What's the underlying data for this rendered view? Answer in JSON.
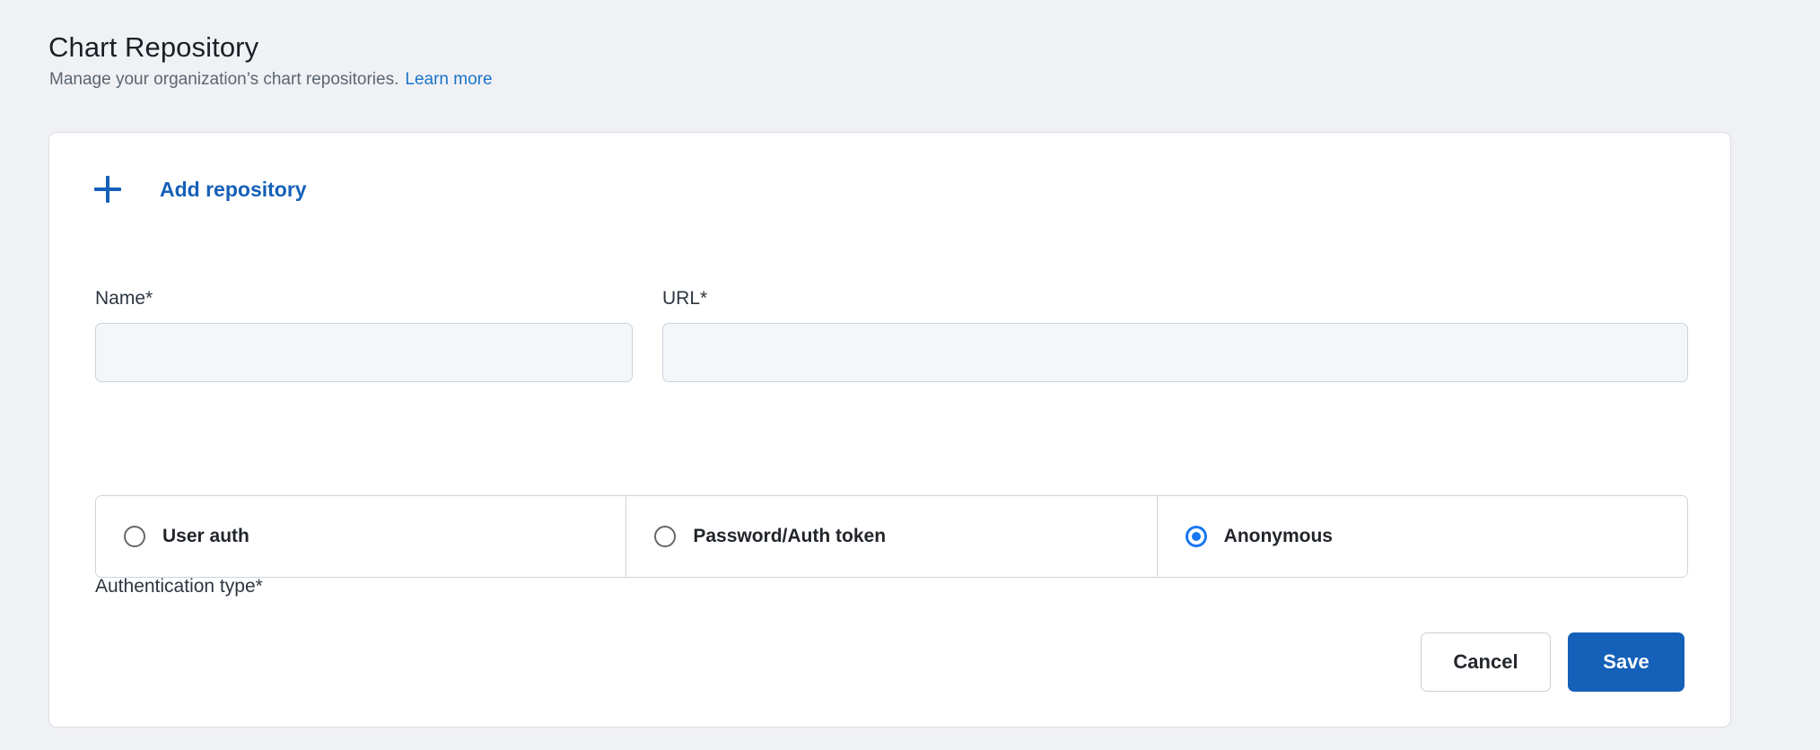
{
  "header": {
    "title": "Chart Repository",
    "subtitle": "Manage your organization’s chart repositories.",
    "learn_more_label": "Learn more"
  },
  "card": {
    "add_repository": {
      "icon": "plus-icon",
      "label": "Add repository"
    },
    "form": {
      "name_field": {
        "label": "Name*",
        "value": "",
        "placeholder": ""
      },
      "url_field": {
        "label": "URL*",
        "value": "",
        "placeholder": ""
      },
      "auth_type": {
        "label": "Authentication type*",
        "selected": "Anonymous",
        "options": [
          {
            "label": "User auth",
            "checked": false
          },
          {
            "label": "Password/Auth token",
            "checked": false
          },
          {
            "label": "Anonymous",
            "checked": true
          }
        ]
      }
    },
    "actions": {
      "cancel_label": "Cancel",
      "save_label": "Save"
    }
  },
  "colors": {
    "page_background": "#f0f1f5",
    "card_background": "#ffffff",
    "card_border": "#d9dde3",
    "accent_blue": "#1560b8",
    "link_blue": "#1a73c7",
    "radio_selected": "#1877f2",
    "input_fill": "#f4f7fa",
    "input_border": "#ccd3db",
    "title_text": "#1b2026",
    "muted_text": "#5b6670"
  }
}
